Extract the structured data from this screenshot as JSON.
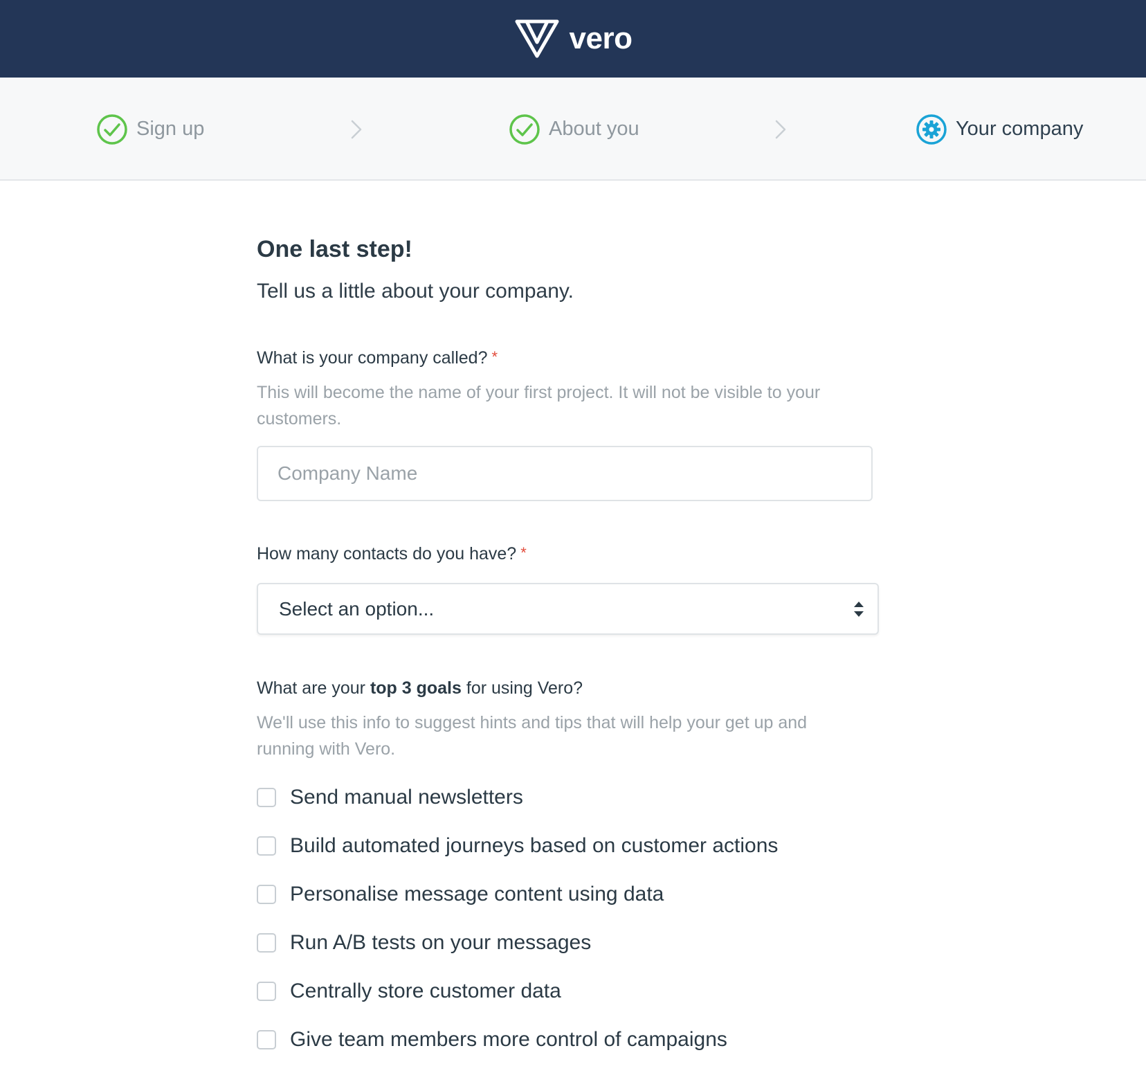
{
  "header": {
    "brand": "vero"
  },
  "steps": [
    {
      "label": "Sign up",
      "status": "complete"
    },
    {
      "label": "About you",
      "status": "complete"
    },
    {
      "label": "Your company",
      "status": "active"
    }
  ],
  "form": {
    "title": "One last step!",
    "subtitle": "Tell us a little about your company.",
    "company": {
      "question": "What is your company called?",
      "required_mark": "*",
      "help": "This will become the name of your first project. It will not be visible to your customers.",
      "placeholder": "Company Name",
      "value": ""
    },
    "contacts": {
      "question": "How many contacts do you have?",
      "required_mark": "*",
      "selected": "Select an option..."
    },
    "goals": {
      "question_prefix": "What are your ",
      "question_bold": "top 3 goals",
      "question_suffix": " for using Vero?",
      "help": "We'll use this info to suggest hints and tips that will help your get up and running with Vero.",
      "options": [
        {
          "label": "Send manual newsletters",
          "checked": false
        },
        {
          "label": "Build automated journeys based on customer actions",
          "checked": false
        },
        {
          "label": "Personalise message content using data",
          "checked": false
        },
        {
          "label": "Run A/B tests on your messages",
          "checked": false
        },
        {
          "label": "Centrally store customer data",
          "checked": false
        },
        {
          "label": "Give team members more control of campaigns",
          "checked": false
        }
      ]
    }
  },
  "colors": {
    "header_bg": "#233657",
    "step_complete": "#5ec44b",
    "step_active": "#1aa3d6",
    "required": "#e24b3b"
  }
}
